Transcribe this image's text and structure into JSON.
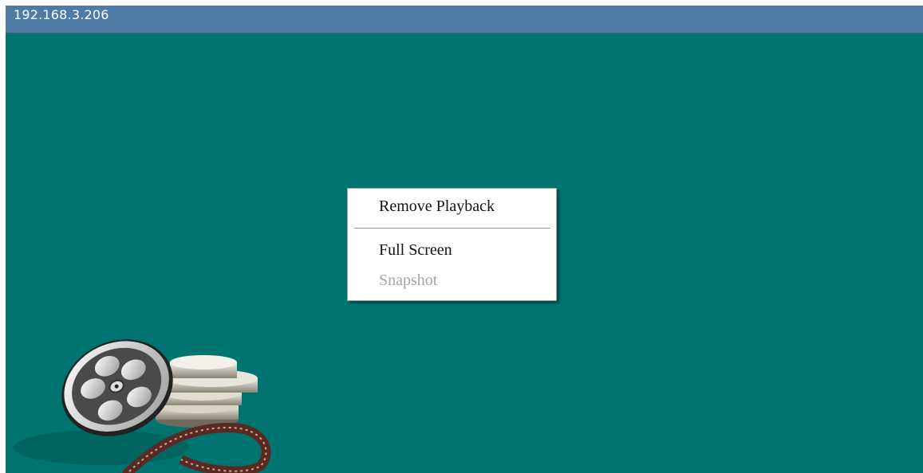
{
  "window": {
    "title": "192.168.3.206"
  },
  "context_menu": {
    "items": [
      {
        "label": "Remove Playback",
        "enabled": true
      },
      {
        "label": "Full Screen",
        "enabled": true
      },
      {
        "label": "Snapshot",
        "enabled": false
      }
    ]
  },
  "colors": {
    "background": "#007470",
    "titlebar": "#4e7ba4",
    "menu_bg": "#ffffff",
    "disabled_text": "#a5a5a5"
  },
  "decor": {
    "icon": "film-reel-icon"
  }
}
